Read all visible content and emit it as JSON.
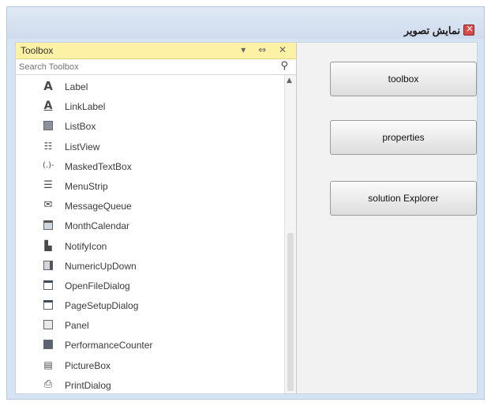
{
  "window": {
    "title": "نمایش تصویر"
  },
  "toolbox": {
    "title": "Toolbox",
    "header_controls": "▾ ⇔ ✕",
    "search_placeholder": "Search Toolbox",
    "items": [
      {
        "label": "Label",
        "icon": "label-a-icon"
      },
      {
        "label": "LinkLabel",
        "icon": "linklabel-icon"
      },
      {
        "label": "ListBox",
        "icon": "listbox-icon"
      },
      {
        "label": "ListView",
        "icon": "listview-icon"
      },
      {
        "label": "MaskedTextBox",
        "icon": "maskedtextbox-icon"
      },
      {
        "label": "MenuStrip",
        "icon": "menustrip-icon"
      },
      {
        "label": "MessageQueue",
        "icon": "messagequeue-icon"
      },
      {
        "label": "MonthCalendar",
        "icon": "monthcalendar-icon"
      },
      {
        "label": "NotifyIcon",
        "icon": "notifyicon-icon"
      },
      {
        "label": "NumericUpDown",
        "icon": "numericupdown-icon"
      },
      {
        "label": "OpenFileDialog",
        "icon": "openfiledialog-icon"
      },
      {
        "label": "PageSetupDialog",
        "icon": "pagesetupdialog-icon"
      },
      {
        "label": "Panel",
        "icon": "panel-icon"
      },
      {
        "label": "PerformanceCounter",
        "icon": "performancecounter-icon"
      },
      {
        "label": "PictureBox",
        "icon": "picturebox-icon"
      },
      {
        "label": "PrintDialog",
        "icon": "printdialog-icon"
      }
    ]
  },
  "buttons": {
    "toolbox": "toolbox",
    "properties": "properties",
    "solution_explorer": "solution Explorer"
  },
  "colors": {
    "toolbox_header": "#fdf1a5",
    "window_frame": "#d6e3f3",
    "close_icon": "#d94c4c"
  }
}
